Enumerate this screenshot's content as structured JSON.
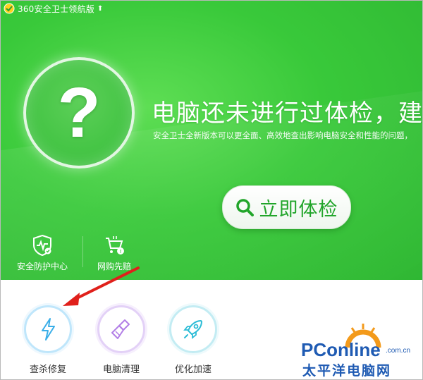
{
  "window": {
    "title": "360安全卫士领航版"
  },
  "hero": {
    "headline": "电脑还未进行过体检，建议立即",
    "subline": "安全卫士全新版本可以更全面、高效地查出影响电脑安全和性能的问题，",
    "check_button_label": "立即体检",
    "tools": [
      {
        "label": "安全防护中心",
        "icon": "shield-heartbeat-icon"
      },
      {
        "label": "网购先赔",
        "icon": "shopping-cart-icon"
      }
    ]
  },
  "functions": [
    {
      "label": "查杀修复",
      "icon": "lightning-icon",
      "color": "#3aaee8"
    },
    {
      "label": "电脑清理",
      "icon": "broom-icon",
      "color": "#b27ee6"
    },
    {
      "label": "优化加速",
      "icon": "rocket-icon",
      "color": "#2cbcd6"
    }
  ],
  "annotation": {
    "arrow_color": "#e0201b"
  },
  "watermark": {
    "brand": "PConline",
    "domain": ".com.cn",
    "chinese": "太平洋电脑网"
  },
  "colors": {
    "hero_green": "#39c93a",
    "button_text_green": "#21a52a"
  }
}
